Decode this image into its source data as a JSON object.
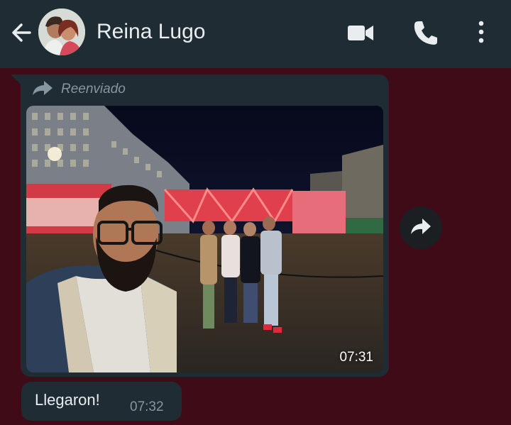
{
  "header": {
    "contact_name": "Reina Lugo",
    "back_icon": "back-arrow-icon",
    "video_icon": "video-call-icon",
    "call_icon": "voice-call-icon",
    "menu_icon": "more-vert-icon"
  },
  "messages": [
    {
      "type": "image",
      "forwarded_label": "Reenviado",
      "time": "07:31"
    },
    {
      "type": "text",
      "text": "Llegaron!",
      "time": "07:32"
    }
  ],
  "colors": {
    "background": "#3f0b17",
    "header": "#1f2c33",
    "bubble": "#1f2c33",
    "meta_text": "#8696a0",
    "text": "#e9edef"
  }
}
